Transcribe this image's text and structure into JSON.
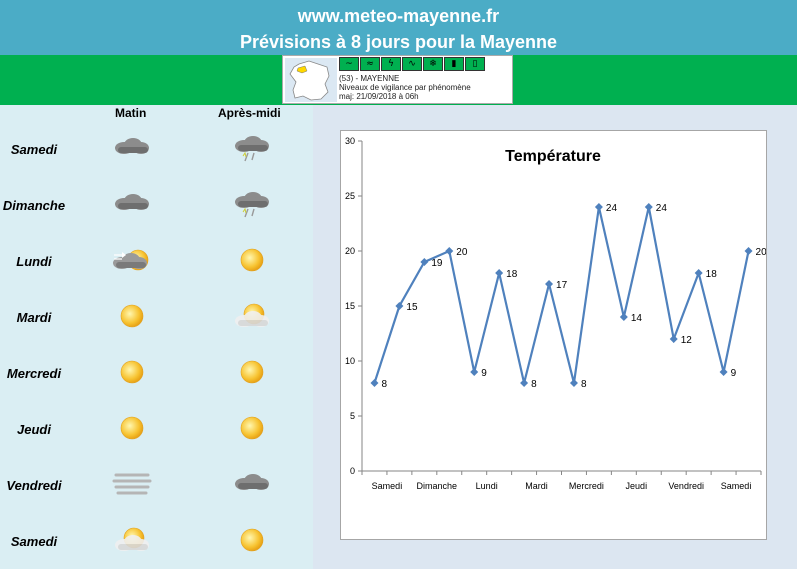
{
  "header": {
    "site": "www.meteo-mayenne.fr",
    "subtitle": "Prévisions à 8 jours pour la Mayenne"
  },
  "vigilance": {
    "line1": "(53) - MAYENNE",
    "line2": "Niveaux de vigilance par phénomène",
    "line3": "maj: 21/09/2018 à 06h",
    "icons": [
      "wind-icon",
      "rain-flood-icon",
      "storm-icon",
      "flood-icon",
      "snow-ice-icon",
      "heat-icon",
      "cold-icon"
    ]
  },
  "forecast": {
    "col_morning": "Matin",
    "col_afternoon": "Après-midi",
    "days": [
      {
        "name": "Samedi",
        "morning": "cloudy-icon",
        "afternoon": "rain-cloud-icon"
      },
      {
        "name": "Dimanche",
        "morning": "cloudy-icon",
        "afternoon": "rain-cloud-icon"
      },
      {
        "name": "Lundi",
        "morning": "sun-cloud-wind-icon",
        "afternoon": "sun-icon"
      },
      {
        "name": "Mardi",
        "morning": "sun-icon",
        "afternoon": "sun-cloudy-icon"
      },
      {
        "name": "Mercredi",
        "morning": "sun-icon",
        "afternoon": "sun-icon"
      },
      {
        "name": "Jeudi",
        "morning": "sun-icon",
        "afternoon": "sun-icon"
      },
      {
        "name": "Vendredi",
        "morning": "fog-icon",
        "afternoon": "cloudy-icon"
      },
      {
        "name": "Samedi",
        "morning": "sun-cloudy-icon",
        "afternoon": "sun-icon"
      }
    ]
  },
  "chart_data": {
    "type": "line",
    "title": "Température",
    "categories": [
      "Samedi",
      "Dimanche",
      "Lundi",
      "Mardi",
      "Mercredi",
      "Jeudi",
      "Vendredi",
      "Samedi"
    ],
    "values": [
      8,
      15,
      19,
      20,
      9,
      18,
      8,
      17,
      8,
      24,
      14,
      24,
      12,
      18,
      9,
      20
    ],
    "ylim": [
      0,
      30
    ],
    "yticks": [
      0,
      5,
      10,
      15,
      20,
      25,
      30
    ],
    "series_color": "#4f81bd",
    "grid": false
  }
}
